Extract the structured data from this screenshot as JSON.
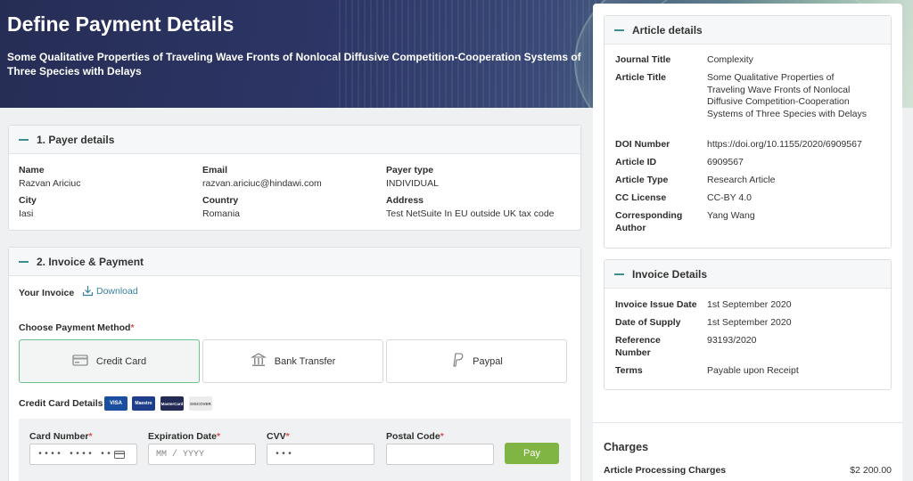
{
  "hero": {
    "title": "Define Payment Details",
    "subtitle": "Some Qualitative Properties of Traveling Wave Fronts of Nonlocal Diffusive Competition-Cooperation Systems of Three Species with Delays"
  },
  "payer": {
    "header": "1. Payer details",
    "name_label": "Name",
    "name": "Razvan Ariciuc",
    "email_label": "Email",
    "email": "razvan.ariciuc@hindawi.com",
    "type_label": "Payer type",
    "type": "INDIVIDUAL",
    "city_label": "City",
    "city": "Iasi",
    "country_label": "Country",
    "country": "Romania",
    "address_label": "Address",
    "address": "Test NetSuite In EU outside UK tax code"
  },
  "invoice_payment": {
    "header": "2. Invoice & Payment",
    "your_invoice": "Your Invoice",
    "download": "Download",
    "choose_method": "Choose Payment Method",
    "required_mark": "*",
    "methods": [
      {
        "label": "Credit Card",
        "icon": "credit-card-icon"
      },
      {
        "label": "Bank Transfer",
        "icon": "bank-icon"
      },
      {
        "label": "Paypal",
        "icon": "paypal-icon"
      }
    ],
    "cc_details_label": "Credit Card Details",
    "card_brands": [
      "VISA",
      "Maestro",
      "MasterCard",
      "DISCOVER"
    ],
    "fields": {
      "card_number_label": "Card Number",
      "card_number_value": "•••• •••• ••",
      "expiration_label": "Expiration Date",
      "expiration_placeholder": "MM / YYYY",
      "cvv_label": "CVV",
      "cvv_value": "•••",
      "postal_label": "Postal Code",
      "postal_value": ""
    },
    "pay_button": "Pay"
  },
  "article": {
    "header": "Article details",
    "rows": [
      {
        "k": "Journal Title",
        "v": "Complexity"
      },
      {
        "k": "Article Title",
        "v": "Some Qualitative Properties of Traveling Wave Fronts of Nonlocal Diffusive Competition-Cooperation Systems of Three Species with Delays"
      },
      {
        "k": "DOI Number",
        "v": "https://doi.org/10.1155/2020/6909567"
      },
      {
        "k": "Article ID",
        "v": "6909567"
      },
      {
        "k": "Article Type",
        "v": "Research Article"
      },
      {
        "k": "CC License",
        "v": "CC-BY 4.0"
      },
      {
        "k": "Corresponding Author",
        "v": "Yang Wang"
      }
    ]
  },
  "invoice_details": {
    "header": "Invoice Details",
    "rows": [
      {
        "k": "Invoice Issue Date",
        "v": "1st September 2020"
      },
      {
        "k": "Date of Supply",
        "v": "1st September 2020"
      },
      {
        "k": "Reference Number",
        "v": "93193/2020"
      },
      {
        "k": "Terms",
        "v": "Payable upon Receipt"
      }
    ]
  },
  "charges": {
    "header": "Charges",
    "apc_label": "Article Processing Charges",
    "apc_value": "$2 200.00"
  },
  "colors": {
    "accent": "#3e8c93",
    "pay_button": "#81b543",
    "required": "#d9534f"
  }
}
